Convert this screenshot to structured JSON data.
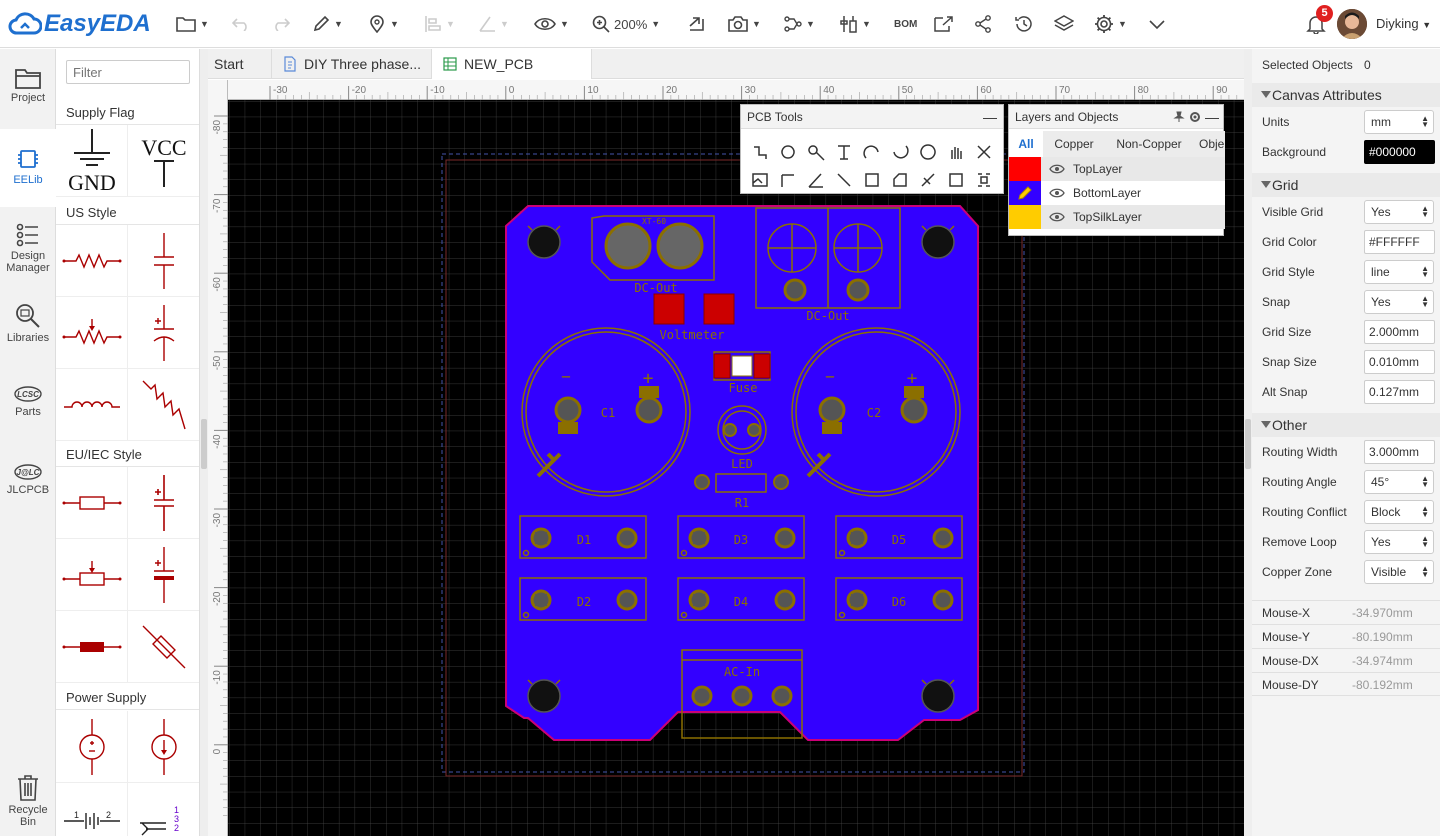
{
  "app": {
    "name": "EasyEDA"
  },
  "toolbar": {
    "zoom": "200%",
    "bom_label": "BOM",
    "notification_count": "5",
    "username": "Diyking"
  },
  "nav": {
    "items": [
      {
        "label": "Project"
      },
      {
        "label": "EELib"
      },
      {
        "label": "Design Manager"
      },
      {
        "label": "Libraries"
      },
      {
        "label": "Parts"
      },
      {
        "label": "JLCPCB"
      },
      {
        "label": "Recycle Bin"
      }
    ]
  },
  "library": {
    "filter_placeholder": "Filter",
    "sections": [
      "Supply Flag",
      "US Style",
      "EU/IEC Style",
      "Power Supply"
    ],
    "gnd_label": "GND",
    "vcc_label": "VCC"
  },
  "tabs": [
    {
      "label": "Start"
    },
    {
      "label": "DIY Three phase..."
    },
    {
      "label": "NEW_PCB"
    }
  ],
  "ruler": {
    "top": [
      "-30",
      "-20",
      "-10",
      "0",
      "10",
      "20",
      "30",
      "40",
      "50",
      "60",
      "70",
      "80",
      "90"
    ],
    "left": [
      "-80",
      "-70",
      "-60",
      "-50",
      "-40",
      "-30",
      "-20",
      "-10",
      "0"
    ]
  },
  "pcb_tools": {
    "title": "PCB Tools"
  },
  "layers_panel": {
    "title": "Layers and Objects",
    "tabs": [
      "All",
      "Copper",
      "Non-Copper",
      "Obje"
    ],
    "layers": [
      {
        "name": "TopLayer",
        "color": "#FF0000"
      },
      {
        "name": "BottomLayer",
        "color": "#3333FF"
      },
      {
        "name": "TopSilkLayer",
        "color": "#FFCC00"
      }
    ]
  },
  "board": {
    "labels": {
      "xt60": "XT-60",
      "dc_out": "DC-Out",
      "voltmeter": "Voltmeter",
      "dc_out2": "DC-Out",
      "fuse": "Fuse",
      "c1": "C1",
      "c2": "C2",
      "led": "LED",
      "r1": "R1",
      "d1": "D1",
      "d2": "D2",
      "d3": "D3",
      "d4": "D4",
      "d5": "D5",
      "d6": "D6",
      "ac_in": "AC-In",
      "minus": "−",
      "plus": "+"
    },
    "colors": {
      "bottom": "#3300FF",
      "silk": "#8B6F00",
      "top": "#CC0000",
      "outline": "#CC0077"
    }
  },
  "props": {
    "selected_label": "Selected Objects",
    "selected_count": "0",
    "canvas_title": "Canvas Attributes",
    "units_label": "Units",
    "units": "mm",
    "background_label": "Background",
    "background": "#000000",
    "grid_title": "Grid",
    "visible_grid_label": "Visible Grid",
    "visible_grid": "Yes",
    "grid_color_label": "Grid Color",
    "grid_color": "#FFFFFF",
    "grid_style_label": "Grid Style",
    "grid_style": "line",
    "snap_label": "Snap",
    "snap": "Yes",
    "grid_size_label": "Grid Size",
    "grid_size": "2.000mm",
    "snap_size_label": "Snap Size",
    "snap_size": "0.010mm",
    "alt_snap_label": "Alt Snap",
    "alt_snap": "0.127mm",
    "other_title": "Other",
    "routing_width_label": "Routing Width",
    "routing_width": "3.000mm",
    "routing_angle_label": "Routing Angle",
    "routing_angle": "45°",
    "routing_conflict_label": "Routing Conflict",
    "routing_conflict": "Block",
    "remove_loop_label": "Remove Loop",
    "remove_loop": "Yes",
    "copper_zone_label": "Copper Zone",
    "copper_zone": "Visible",
    "mouse_x_label": "Mouse-X",
    "mouse_x": "-34.970mm",
    "mouse_y_label": "Mouse-Y",
    "mouse_y": "-80.190mm",
    "mouse_dx_label": "Mouse-DX",
    "mouse_dx": "-34.974mm",
    "mouse_dy_label": "Mouse-DY",
    "mouse_dy": "-80.192mm"
  }
}
